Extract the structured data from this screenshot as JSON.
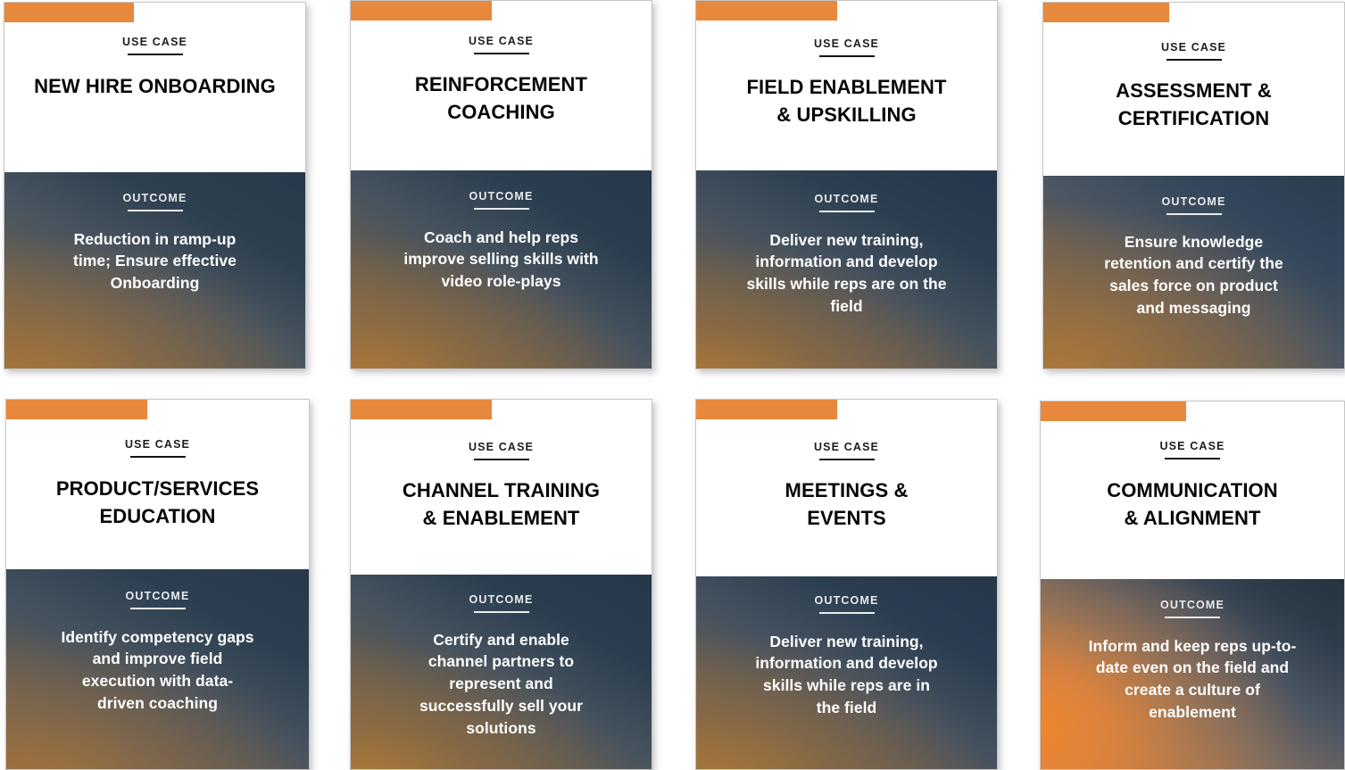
{
  "theme": {
    "accent_orange": "#e8883c",
    "card_border": "#c4c6c8",
    "panel_white": "#ffffff",
    "panel_dark_blue": "#2e4050",
    "panel_warm_brown": "#8a6a45",
    "title_color": "#060606",
    "outcome_text_color": "#ffffff"
  },
  "labels": {
    "use_case": "USE CASE",
    "outcome": "OUTCOME"
  },
  "cards": [
    {
      "eyebrow": "USE CASE",
      "title": "NEW HIRE ONBOARDING",
      "outcome_label": "OUTCOME",
      "outcome": "Reduction in ramp-up\ntime; Ensure effective\nOnboarding"
    },
    {
      "eyebrow": "USE CASE",
      "title": "REINFORCEMENT\nCOACHING",
      "outcome_label": "OUTCOME",
      "outcome": "Coach and help reps\nimprove selling skills with\nvideo role-plays"
    },
    {
      "eyebrow": "USE CASE",
      "title": "FIELD ENABLEMENT\n&  UPSKILLING",
      "outcome_label": "OUTCOME",
      "outcome": "Deliver new training,\ninformation and develop\nskills while reps are on the\nfield"
    },
    {
      "eyebrow": "USE CASE",
      "title": "ASSESSMENT &\nCERTIFICATION",
      "outcome_label": "OUTCOME",
      "outcome": "Ensure knowledge\nretention and certify the\nsales force on product\nand messaging"
    },
    {
      "eyebrow": "USE CASE",
      "title": "PRODUCT/SERVICES\nEDUCATION",
      "outcome_label": "OUTCOME",
      "outcome": "Identify competency gaps\nand improve field\nexecution with data-\ndriven coaching"
    },
    {
      "eyebrow": "USE CASE",
      "title": "CHANNEL TRAINING\n& ENABLEMENT",
      "outcome_label": "OUTCOME",
      "outcome": "Certify and enable\nchannel partners to\nrepresent and\nsuccessfully sell your\nsolutions"
    },
    {
      "eyebrow": "USE CASE",
      "title": "MEETINGS &\nEVENTS",
      "outcome_label": "OUTCOME",
      "outcome": "Deliver new training,\ninformation and develop\nskills while reps are in\nthe field"
    },
    {
      "eyebrow": "USE CASE",
      "title": "COMMUNICATION\n& ALIGNMENT",
      "outcome_label": "OUTCOME",
      "outcome": "Inform and keep reps up-to-\ndate even on the field and\ncreate a culture of\nenablement"
    }
  ]
}
